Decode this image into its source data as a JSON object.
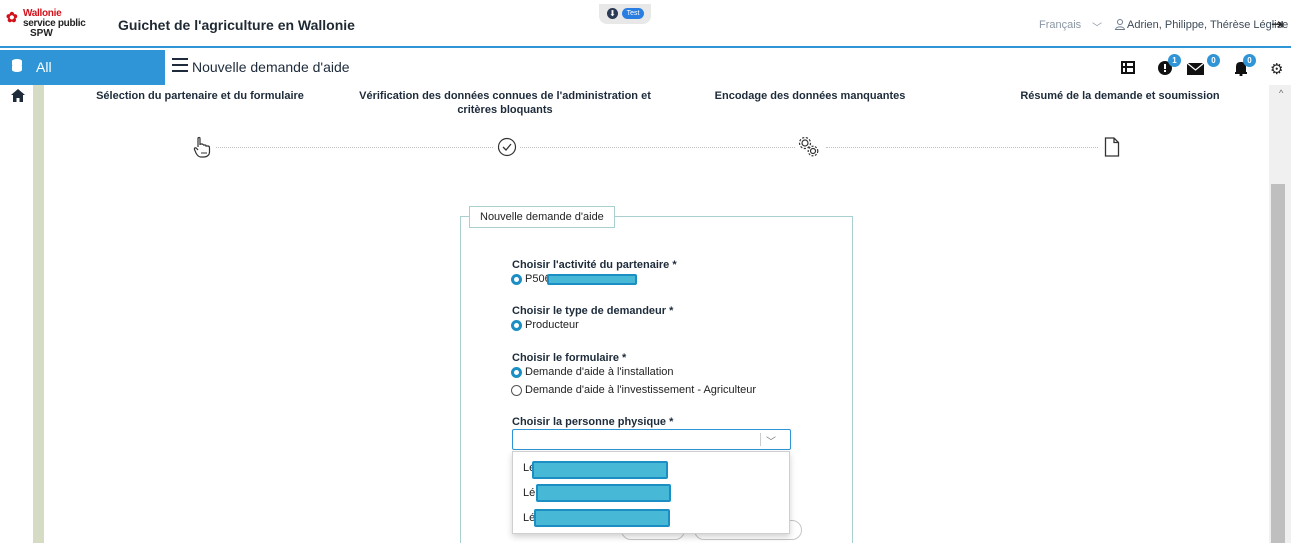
{
  "header": {
    "logo_lines": [
      "Wallonie",
      "service public",
      "SPW"
    ],
    "app_title": "Guichet de l'agriculture en Wallonie",
    "env_badge": "Test",
    "language": "Français",
    "user_name": "Adrien, Philippe, Thérèse Léglise"
  },
  "nav": {
    "all_label": "All",
    "page_title": "Nouvelle demande d'aide",
    "badges": {
      "alerts": "1",
      "messages": "0",
      "notifications": "0"
    },
    "accent_color": "#2f95d6"
  },
  "steps": [
    {
      "label": "Sélection du partenaire et du formulaire",
      "icon": "pointer-hand-icon"
    },
    {
      "label": "Vérification des données connues de l'administration et critères bloquants",
      "icon": "check-circle-icon"
    },
    {
      "label": "Encodage des données manquantes",
      "icon": "gears-icon"
    },
    {
      "label": "Résumé de la demande et soumission",
      "icon": "document-icon"
    }
  ],
  "form": {
    "legend": "Nouvelle demande d'aide",
    "activity": {
      "label": "Choisir l'activité du partenaire *",
      "option": "P506"
    },
    "applicant_type": {
      "label": "Choisir le type de demandeur *",
      "option": "Producteur"
    },
    "form_choice": {
      "label": "Choisir le formulaire *",
      "options": [
        "Demande d'aide à l'installation",
        "Demande d'aide à l'investissement - Agriculteur"
      ]
    },
    "person": {
      "label": "Choisir la personne physique *",
      "value": "",
      "dropdown_items": [
        "Lé",
        "Lé",
        "Lé"
      ]
    }
  }
}
